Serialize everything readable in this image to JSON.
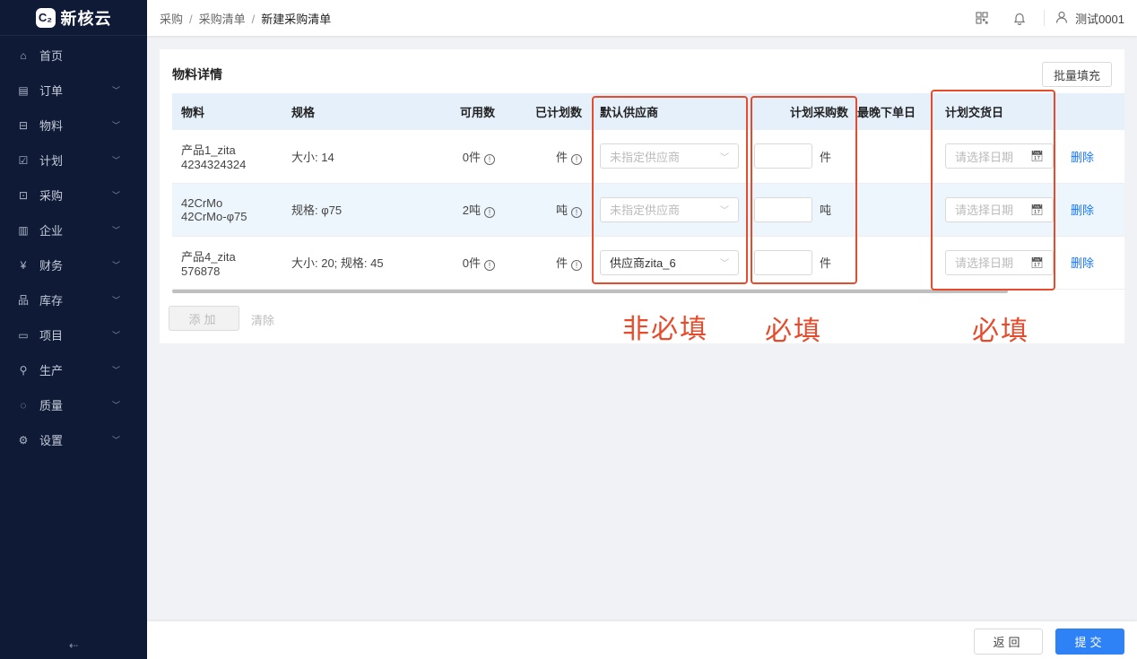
{
  "app": {
    "logo_mark": "C₂",
    "name": "新核云"
  },
  "sidebar": {
    "items": [
      {
        "label": "首页",
        "icon": "⌂",
        "has_chevron": false
      },
      {
        "label": "订单",
        "icon": "▤",
        "has_chevron": true
      },
      {
        "label": "物料",
        "icon": "⊟",
        "has_chevron": true
      },
      {
        "label": "计划",
        "icon": "☑",
        "has_chevron": true
      },
      {
        "label": "采购",
        "icon": "⊡",
        "has_chevron": true
      },
      {
        "label": "企业",
        "icon": "▥",
        "has_chevron": true
      },
      {
        "label": "财务",
        "icon": "¥",
        "has_chevron": true
      },
      {
        "label": "库存",
        "icon": "品",
        "has_chevron": true
      },
      {
        "label": "项目",
        "icon": "▭",
        "has_chevron": true
      },
      {
        "label": "生产",
        "icon": "⚲",
        "has_chevron": true
      },
      {
        "label": "质量",
        "icon": "◌",
        "has_chevron": true
      },
      {
        "label": "设置",
        "icon": "⚙",
        "has_chevron": true
      }
    ],
    "collapse_label": "⇠"
  },
  "breadcrumb": {
    "level1": "采购",
    "level2": "采购清单",
    "current": "新建采购清单",
    "sep": "/"
  },
  "header": {
    "user": "测试0001"
  },
  "card": {
    "title": "物料详情",
    "batch_fill": "批量填充",
    "columns": {
      "material": "物料",
      "spec": "规格",
      "available": "可用数",
      "planned": "已计划数",
      "supplier": "默认供应商",
      "plan_qty": "计划采购数",
      "latest_order": "最晚下单日",
      "delivery": "计划交货日"
    },
    "rows": [
      {
        "name": "产品1_zita",
        "code": "4234324324",
        "spec": "大小: 14",
        "available": "0件",
        "planned": "件",
        "supplier": "未指定供应商",
        "unit": "件",
        "date_placeholder": "请选择日期",
        "action": "删除"
      },
      {
        "name": "42CrMo",
        "code": "42CrMo-φ75",
        "spec": "规格: φ75",
        "available": "2吨",
        "planned": "吨",
        "supplier": "未指定供应商",
        "unit": "吨",
        "date_placeholder": "请选择日期",
        "action": "删除"
      },
      {
        "name": "产品4_zita",
        "code": "576878",
        "spec": "大小: 20; 规格: 45",
        "available": "0件",
        "planned": "件",
        "supplier": "供应商zita_6",
        "unit": "件",
        "date_placeholder": "请选择日期",
        "action": "删除"
      }
    ],
    "add": "添加",
    "clear": "清除"
  },
  "annotations": {
    "supplier": "非必填",
    "plan_qty": "必填",
    "delivery": "必填",
    "color": "#e84b2b"
  },
  "footer": {
    "back": "返回",
    "submit": "提交"
  }
}
